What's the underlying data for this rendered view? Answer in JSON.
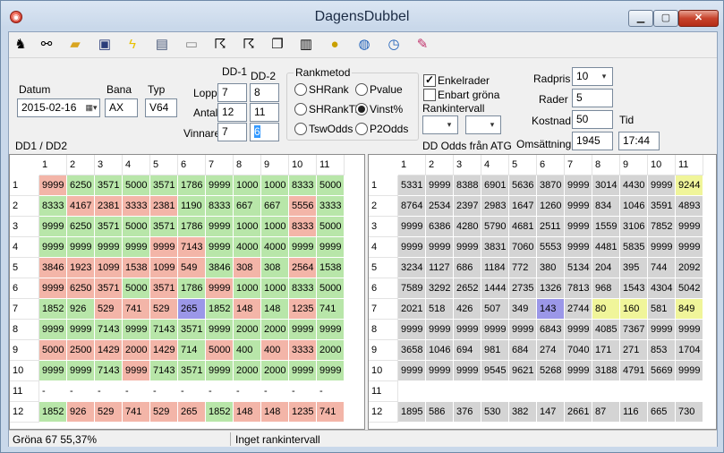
{
  "window": {
    "title": "DagensDubbel"
  },
  "toolbar": {
    "icons": [
      "horse-icon",
      "binoculars-icon",
      "open-folder-icon",
      "save-icon",
      "lightning-icon",
      "card-icon",
      "screen-icon",
      "runner-icon",
      "runner2-icon",
      "copy-icon",
      "notes-icon",
      "coins-icon",
      "globe-icon",
      "clock-icon",
      "eraser-icon"
    ]
  },
  "form": {
    "datum_label": "Datum",
    "datum_value": "2015-02-16",
    "bana_label": "Bana",
    "bana_value": "AX",
    "typ_label": "Typ",
    "typ_value": "V64",
    "dd1_label": "DD-1",
    "dd2_label": "DD-2",
    "lopp_label": "Lopp",
    "lopp_dd1": "7",
    "lopp_dd2": "8",
    "antal_label": "Antal",
    "antal_dd1": "12",
    "antal_dd2": "11",
    "vinnare_label": "Vinnare",
    "vinnare_dd1": "7",
    "vinnare_dd2": "6",
    "dd_caption": "DD1 / DD2",
    "rankmetod_label": "Rankmetod",
    "radios": [
      {
        "label": "SHRank",
        "checked": false
      },
      {
        "label": "Pvalue",
        "checked": false
      },
      {
        "label": "SHRankTid",
        "checked": false
      },
      {
        "label": "Vinst%",
        "checked": true
      },
      {
        "label": "TswOdds",
        "checked": false
      },
      {
        "label": "P2Odds",
        "checked": false
      }
    ],
    "enkelrader_label": "Enkelrader",
    "enkelrader_checked": true,
    "enbart_label": "Enbart gröna",
    "enbart_checked": false,
    "rankintervall_label": "Rankintervall",
    "dd_odds_label": "DD Odds från ATG",
    "radpris_label": "Radpris",
    "radpris_value": "10",
    "rader_label": "Rader",
    "rader_value": "5",
    "kostnad_label": "Kostnad",
    "kostnad_value": "50",
    "tid_label": "Tid",
    "tid_value": "17:44",
    "omsattning_label": "Omsättning",
    "omsattning_value": "1945"
  },
  "left_grid": {
    "cols": [
      "1",
      "2",
      "3",
      "4",
      "5",
      "6",
      "7",
      "8",
      "9",
      "10",
      "11"
    ],
    "rows": [
      {
        "h": "1",
        "cells": [
          [
            "9999",
            "r"
          ],
          [
            "6250",
            "g"
          ],
          [
            "3571",
            "g"
          ],
          [
            "5000",
            "g"
          ],
          [
            "3571",
            "g"
          ],
          [
            "1786",
            "g"
          ],
          [
            "9999",
            "g"
          ],
          [
            "1000",
            "g"
          ],
          [
            "1000",
            "g"
          ],
          [
            "8333",
            "g"
          ],
          [
            "5000",
            "g"
          ]
        ]
      },
      {
        "h": "2",
        "cells": [
          [
            "8333",
            "g"
          ],
          [
            "4167",
            "r"
          ],
          [
            "2381",
            "r"
          ],
          [
            "3333",
            "r"
          ],
          [
            "2381",
            "r"
          ],
          [
            "1190",
            "g"
          ],
          [
            "8333",
            "g"
          ],
          [
            "667",
            "g"
          ],
          [
            "667",
            "g"
          ],
          [
            "5556",
            "r"
          ],
          [
            "3333",
            "g"
          ]
        ]
      },
      {
        "h": "3",
        "cells": [
          [
            "9999",
            "g"
          ],
          [
            "6250",
            "g"
          ],
          [
            "3571",
            "g"
          ],
          [
            "5000",
            "g"
          ],
          [
            "3571",
            "g"
          ],
          [
            "1786",
            "g"
          ],
          [
            "9999",
            "g"
          ],
          [
            "1000",
            "g"
          ],
          [
            "1000",
            "g"
          ],
          [
            "8333",
            "r"
          ],
          [
            "5000",
            "g"
          ]
        ]
      },
      {
        "h": "4",
        "cells": [
          [
            "9999",
            "g"
          ],
          [
            "9999",
            "g"
          ],
          [
            "9999",
            "g"
          ],
          [
            "9999",
            "g"
          ],
          [
            "9999",
            "r"
          ],
          [
            "7143",
            "r"
          ],
          [
            "9999",
            "g"
          ],
          [
            "4000",
            "g"
          ],
          [
            "4000",
            "g"
          ],
          [
            "9999",
            "g"
          ],
          [
            "9999",
            "g"
          ]
        ]
      },
      {
        "h": "5",
        "cells": [
          [
            "3846",
            "r"
          ],
          [
            "1923",
            "r"
          ],
          [
            "1099",
            "r"
          ],
          [
            "1538",
            "r"
          ],
          [
            "1099",
            "r"
          ],
          [
            "549",
            "r"
          ],
          [
            "3846",
            "g"
          ],
          [
            "308",
            "r"
          ],
          [
            "308",
            "g"
          ],
          [
            "2564",
            "r"
          ],
          [
            "1538",
            "g"
          ]
        ]
      },
      {
        "h": "6",
        "cells": [
          [
            "9999",
            "r"
          ],
          [
            "6250",
            "r"
          ],
          [
            "3571",
            "r"
          ],
          [
            "5000",
            "g"
          ],
          [
            "3571",
            "r"
          ],
          [
            "1786",
            "g"
          ],
          [
            "9999",
            "r"
          ],
          [
            "1000",
            "g"
          ],
          [
            "1000",
            "g"
          ],
          [
            "8333",
            "g"
          ],
          [
            "5000",
            "g"
          ]
        ]
      },
      {
        "h": "7",
        "cells": [
          [
            "1852",
            "g"
          ],
          [
            "926",
            "g"
          ],
          [
            "529",
            "r"
          ],
          [
            "741",
            "r"
          ],
          [
            "529",
            "r"
          ],
          [
            "265",
            "b"
          ],
          [
            "1852",
            "g"
          ],
          [
            "148",
            "r"
          ],
          [
            "148",
            "g"
          ],
          [
            "1235",
            "r"
          ],
          [
            "741",
            "g"
          ]
        ]
      },
      {
        "h": "8",
        "cells": [
          [
            "9999",
            "g"
          ],
          [
            "9999",
            "g"
          ],
          [
            "7143",
            "g"
          ],
          [
            "9999",
            "g"
          ],
          [
            "7143",
            "g"
          ],
          [
            "3571",
            "g"
          ],
          [
            "9999",
            "g"
          ],
          [
            "2000",
            "g"
          ],
          [
            "2000",
            "g"
          ],
          [
            "9999",
            "g"
          ],
          [
            "9999",
            "g"
          ]
        ]
      },
      {
        "h": "9",
        "cells": [
          [
            "5000",
            "r"
          ],
          [
            "2500",
            "r"
          ],
          [
            "1429",
            "r"
          ],
          [
            "2000",
            "r"
          ],
          [
            "1429",
            "r"
          ],
          [
            "714",
            "g"
          ],
          [
            "5000",
            "r"
          ],
          [
            "400",
            "g"
          ],
          [
            "400",
            "r"
          ],
          [
            "3333",
            "r"
          ],
          [
            "2000",
            "g"
          ]
        ]
      },
      {
        "h": "10",
        "cells": [
          [
            "9999",
            "g"
          ],
          [
            "9999",
            "g"
          ],
          [
            "7143",
            "g"
          ],
          [
            "9999",
            "r"
          ],
          [
            "7143",
            "g"
          ],
          [
            "3571",
            "g"
          ],
          [
            "9999",
            "g"
          ],
          [
            "2000",
            "g"
          ],
          [
            "2000",
            "g"
          ],
          [
            "9999",
            "g"
          ],
          [
            "9999",
            "g"
          ]
        ]
      },
      {
        "h": "11",
        "cells": [
          [
            "-",
            "w"
          ],
          [
            "-",
            "w"
          ],
          [
            "-",
            "w"
          ],
          [
            "-",
            "w"
          ],
          [
            "-",
            "w"
          ],
          [
            "-",
            "w"
          ],
          [
            "-",
            "w"
          ],
          [
            "-",
            "w"
          ],
          [
            "-",
            "w"
          ],
          [
            "-",
            "w"
          ],
          [
            "-",
            "w"
          ]
        ]
      },
      {
        "h": "12",
        "cells": [
          [
            "1852",
            "g"
          ],
          [
            "926",
            "r"
          ],
          [
            "529",
            "r"
          ],
          [
            "741",
            "r"
          ],
          [
            "529",
            "r"
          ],
          [
            "265",
            "r"
          ],
          [
            "1852",
            "g"
          ],
          [
            "148",
            "r"
          ],
          [
            "148",
            "r"
          ],
          [
            "1235",
            "r"
          ],
          [
            "741",
            "r"
          ]
        ]
      }
    ]
  },
  "right_grid": {
    "cols": [
      "1",
      "2",
      "3",
      "4",
      "5",
      "6",
      "7",
      "8",
      "9",
      "10",
      "11"
    ],
    "rows": [
      {
        "h": "1",
        "cells": [
          [
            "5331",
            "gr"
          ],
          [
            "9999",
            "gr"
          ],
          [
            "8388",
            "gr"
          ],
          [
            "6901",
            "gr"
          ],
          [
            "5636",
            "gr"
          ],
          [
            "3870",
            "gr"
          ],
          [
            "9999",
            "gr"
          ],
          [
            "3014",
            "gr"
          ],
          [
            "4430",
            "gr"
          ],
          [
            "9999",
            "gr"
          ],
          [
            "9244",
            "y"
          ]
        ]
      },
      {
        "h": "2",
        "cells": [
          [
            "8764",
            "gr"
          ],
          [
            "2534",
            "gr"
          ],
          [
            "2397",
            "gr"
          ],
          [
            "2983",
            "gr"
          ],
          [
            "1647",
            "gr"
          ],
          [
            "1260",
            "gr"
          ],
          [
            "9999",
            "gr"
          ],
          [
            "834",
            "gr"
          ],
          [
            "1046",
            "gr"
          ],
          [
            "3591",
            "gr"
          ],
          [
            "4893",
            "gr"
          ]
        ]
      },
      {
        "h": "3",
        "cells": [
          [
            "9999",
            "gr"
          ],
          [
            "6386",
            "gr"
          ],
          [
            "4280",
            "gr"
          ],
          [
            "5790",
            "gr"
          ],
          [
            "4681",
            "gr"
          ],
          [
            "2511",
            "gr"
          ],
          [
            "9999",
            "gr"
          ],
          [
            "1559",
            "gr"
          ],
          [
            "3106",
            "gr"
          ],
          [
            "7852",
            "gr"
          ],
          [
            "9999",
            "gr"
          ]
        ]
      },
      {
        "h": "4",
        "cells": [
          [
            "9999",
            "gr"
          ],
          [
            "9999",
            "gr"
          ],
          [
            "9999",
            "gr"
          ],
          [
            "3831",
            "gr"
          ],
          [
            "7060",
            "gr"
          ],
          [
            "5553",
            "gr"
          ],
          [
            "9999",
            "gr"
          ],
          [
            "4481",
            "gr"
          ],
          [
            "5835",
            "gr"
          ],
          [
            "9999",
            "gr"
          ],
          [
            "9999",
            "gr"
          ]
        ]
      },
      {
        "h": "5",
        "cells": [
          [
            "3234",
            "gr"
          ],
          [
            "1127",
            "gr"
          ],
          [
            "686",
            "gr"
          ],
          [
            "1184",
            "gr"
          ],
          [
            "772",
            "gr"
          ],
          [
            "380",
            "gr"
          ],
          [
            "5134",
            "gr"
          ],
          [
            "204",
            "gr"
          ],
          [
            "395",
            "gr"
          ],
          [
            "744",
            "gr"
          ],
          [
            "2092",
            "gr"
          ]
        ]
      },
      {
        "h": "6",
        "cells": [
          [
            "7589",
            "gr"
          ],
          [
            "3292",
            "gr"
          ],
          [
            "2652",
            "gr"
          ],
          [
            "1444",
            "gr"
          ],
          [
            "2735",
            "gr"
          ],
          [
            "1326",
            "gr"
          ],
          [
            "7813",
            "gr"
          ],
          [
            "968",
            "gr"
          ],
          [
            "1543",
            "gr"
          ],
          [
            "4304",
            "gr"
          ],
          [
            "5042",
            "gr"
          ]
        ]
      },
      {
        "h": "7",
        "cells": [
          [
            "2021",
            "gr"
          ],
          [
            "518",
            "gr"
          ],
          [
            "426",
            "gr"
          ],
          [
            "507",
            "gr"
          ],
          [
            "349",
            "gr"
          ],
          [
            "143",
            "b"
          ],
          [
            "2744",
            "gr"
          ],
          [
            "80",
            "y"
          ],
          [
            "160",
            "y"
          ],
          [
            "581",
            "gr"
          ],
          [
            "849",
            "y"
          ]
        ]
      },
      {
        "h": "8",
        "cells": [
          [
            "9999",
            "gr"
          ],
          [
            "9999",
            "gr"
          ],
          [
            "9999",
            "gr"
          ],
          [
            "9999",
            "gr"
          ],
          [
            "9999",
            "gr"
          ],
          [
            "6843",
            "gr"
          ],
          [
            "9999",
            "gr"
          ],
          [
            "4085",
            "gr"
          ],
          [
            "7367",
            "gr"
          ],
          [
            "9999",
            "gr"
          ],
          [
            "9999",
            "gr"
          ]
        ]
      },
      {
        "h": "9",
        "cells": [
          [
            "3658",
            "gr"
          ],
          [
            "1046",
            "gr"
          ],
          [
            "694",
            "gr"
          ],
          [
            "981",
            "gr"
          ],
          [
            "684",
            "gr"
          ],
          [
            "274",
            "gr"
          ],
          [
            "7040",
            "gr"
          ],
          [
            "171",
            "gr"
          ],
          [
            "271",
            "gr"
          ],
          [
            "853",
            "gr"
          ],
          [
            "1704",
            "gr"
          ]
        ]
      },
      {
        "h": "10",
        "cells": [
          [
            "9999",
            "gr"
          ],
          [
            "9999",
            "gr"
          ],
          [
            "9999",
            "gr"
          ],
          [
            "9545",
            "gr"
          ],
          [
            "9621",
            "gr"
          ],
          [
            "5268",
            "gr"
          ],
          [
            "9999",
            "gr"
          ],
          [
            "3188",
            "gr"
          ],
          [
            "4791",
            "gr"
          ],
          [
            "5669",
            "gr"
          ],
          [
            "9999",
            "gr"
          ]
        ]
      },
      {
        "h": "11",
        "cells": [
          [
            "",
            "w"
          ],
          [
            "",
            "w"
          ],
          [
            "",
            "w"
          ],
          [
            "",
            "w"
          ],
          [
            "",
            "w"
          ],
          [
            "",
            "w"
          ],
          [
            "",
            "w"
          ],
          [
            "",
            "w"
          ],
          [
            "",
            "w"
          ],
          [
            "",
            "w"
          ],
          [
            "",
            "w"
          ]
        ]
      },
      {
        "h": "12",
        "cells": [
          [
            "1895",
            "gr"
          ],
          [
            "586",
            "gr"
          ],
          [
            "376",
            "gr"
          ],
          [
            "530",
            "gr"
          ],
          [
            "382",
            "gr"
          ],
          [
            "147",
            "gr"
          ],
          [
            "2661",
            "gr"
          ],
          [
            "87",
            "gr"
          ],
          [
            "116",
            "gr"
          ],
          [
            "665",
            "gr"
          ],
          [
            "730",
            "gr"
          ]
        ]
      }
    ]
  },
  "status": {
    "left": "Gröna 67  55,37%",
    "middle": "Inget rankintervall"
  }
}
